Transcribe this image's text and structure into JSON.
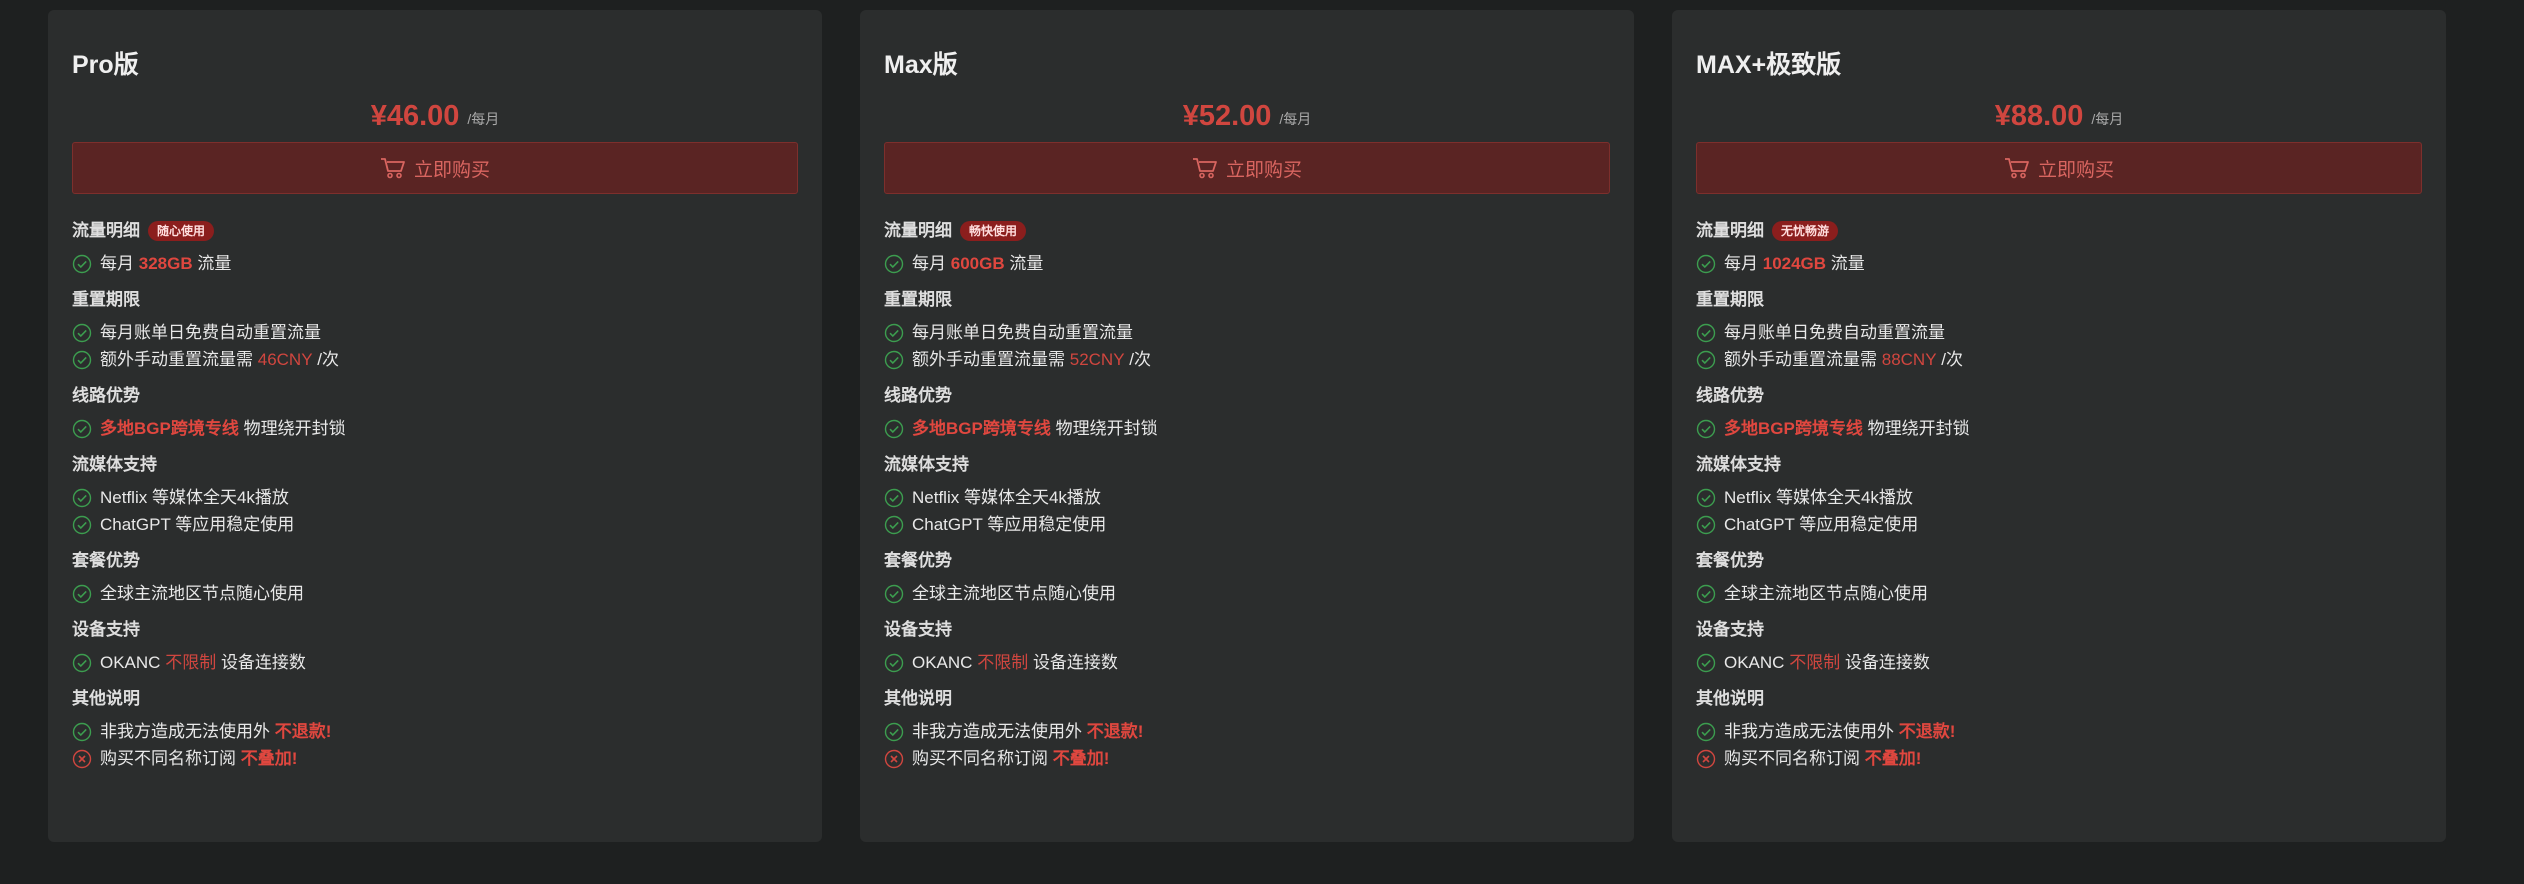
{
  "colors": {
    "background": "#1e2020",
    "card": "#2b2d2d",
    "accent": "#d0463f",
    "button_bg": "#5a2423",
    "check": "#3c9d4f",
    "cross": "#d0463f"
  },
  "plans": [
    {
      "title": "Pro版",
      "price": "¥46.00",
      "unit": "/每月",
      "buy_label": "立即购买",
      "traffic": {
        "title": "流量明细",
        "badge": "随心使用",
        "prefix": "每月",
        "amount": "328GB",
        "suffix": "流量"
      },
      "reset": {
        "title": "重置期限",
        "line1": "每月账单日免费自动重置流量",
        "line2_prefix": "额外手动重置流量需",
        "line2_price": "46CNY",
        "line2_suffix": "/次"
      },
      "route": {
        "title": "线路优势",
        "highlight": "多地BGP跨境专线",
        "text": "物理绕开封锁"
      },
      "streaming": {
        "title": "流媒体支持",
        "line1": "Netflix 等媒体全天4k播放",
        "line2": "ChatGPT 等应用稳定使用"
      },
      "advantage": {
        "title": "套餐优势",
        "line1": "全球主流地区节点随心使用"
      },
      "device": {
        "title": "设备支持",
        "prefix": "OKANC",
        "highlight": "不限制",
        "suffix": "设备连接数"
      },
      "other": {
        "title": "其他说明",
        "line1_text": "非我方造成无法使用外",
        "line1_highlight": "不退款!",
        "line2_text": "购买不同名称订阅",
        "line2_highlight": "不叠加!"
      }
    },
    {
      "title": "Max版",
      "price": "¥52.00",
      "unit": "/每月",
      "buy_label": "立即购买",
      "traffic": {
        "title": "流量明细",
        "badge": "畅快使用",
        "prefix": "每月",
        "amount": "600GB",
        "suffix": "流量"
      },
      "reset": {
        "title": "重置期限",
        "line1": "每月账单日免费自动重置流量",
        "line2_prefix": "额外手动重置流量需",
        "line2_price": "52CNY",
        "line2_suffix": "/次"
      },
      "route": {
        "title": "线路优势",
        "highlight": "多地BGP跨境专线",
        "text": "物理绕开封锁"
      },
      "streaming": {
        "title": "流媒体支持",
        "line1": "Netflix 等媒体全天4k播放",
        "line2": "ChatGPT 等应用稳定使用"
      },
      "advantage": {
        "title": "套餐优势",
        "line1": "全球主流地区节点随心使用"
      },
      "device": {
        "title": "设备支持",
        "prefix": "OKANC",
        "highlight": "不限制",
        "suffix": "设备连接数"
      },
      "other": {
        "title": "其他说明",
        "line1_text": "非我方造成无法使用外",
        "line1_highlight": "不退款!",
        "line2_text": "购买不同名称订阅",
        "line2_highlight": "不叠加!"
      }
    },
    {
      "title": "MAX+极致版",
      "price": "¥88.00",
      "unit": "/每月",
      "buy_label": "立即购买",
      "traffic": {
        "title": "流量明细",
        "badge": "无忧畅游",
        "prefix": "每月",
        "amount": "1024GB",
        "suffix": "流量"
      },
      "reset": {
        "title": "重置期限",
        "line1": "每月账单日免费自动重置流量",
        "line2_prefix": "额外手动重置流量需",
        "line2_price": "88CNY",
        "line2_suffix": "/次"
      },
      "route": {
        "title": "线路优势",
        "highlight": "多地BGP跨境专线",
        "text": "物理绕开封锁"
      },
      "streaming": {
        "title": "流媒体支持",
        "line1": "Netflix 等媒体全天4k播放",
        "line2": "ChatGPT 等应用稳定使用"
      },
      "advantage": {
        "title": "套餐优势",
        "line1": "全球主流地区节点随心使用"
      },
      "device": {
        "title": "设备支持",
        "prefix": "OKANC",
        "highlight": "不限制",
        "suffix": "设备连接数"
      },
      "other": {
        "title": "其他说明",
        "line1_text": "非我方造成无法使用外",
        "line1_highlight": "不退款!",
        "line2_text": "购买不同名称订阅",
        "line2_highlight": "不叠加!"
      }
    }
  ]
}
